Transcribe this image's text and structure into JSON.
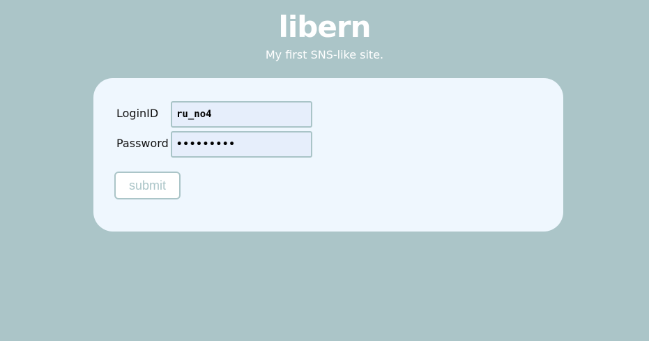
{
  "header": {
    "logo_text": "libern",
    "tagline": "My first SNS-like site."
  },
  "form": {
    "login_label": "LoginID",
    "login_value": "ru_no4",
    "password_label": "Password",
    "password_value": "123456789",
    "submit_label": "submit"
  },
  "colors": {
    "page_background": "#abc5c8",
    "card_background": "#eff7fe",
    "input_background": "#e6eefb",
    "accent": "#abc5c8"
  }
}
